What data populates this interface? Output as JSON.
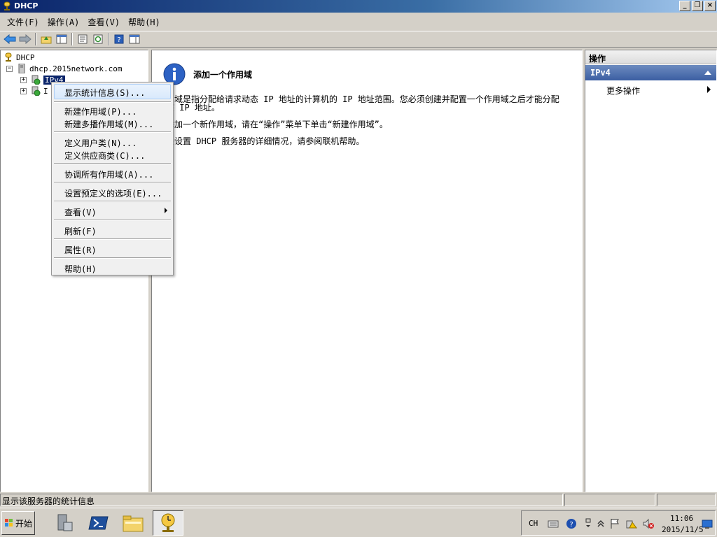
{
  "window": {
    "title": "DHCP"
  },
  "menu": [
    "文件(F)",
    "操作(A)",
    "查看(V)",
    "帮助(H)"
  ],
  "tree": {
    "root": "DHCP",
    "server": "dhcp.2015network.com",
    "ipv4": "IPv4",
    "ipv6_partial": "I"
  },
  "context_menu": {
    "items": [
      "显示统计信息(S)...",
      "新建作用域(P)...",
      "新建多播作用域(M)...",
      "定义用户类(N)...",
      "定义供应商类(C)...",
      "协调所有作用域(A)...",
      "设置预定义的选项(E)...",
      "查看(V)",
      "刷新(F)",
      "属性(R)",
      "帮助(H)"
    ]
  },
  "center": {
    "title": "添加一个作用域",
    "line1": "用域是指分配给请求动态 IP 地址的计算机的 IP 地址范围。您必须创建并配置一个作用域之后才能分配",
    "line2": "态 IP 地址。",
    "line3": "添加一个新作用域，请在“操作”菜单下单击“新建作用域”。",
    "line4": "关设置 DHCP 服务器的详细情况，请参阅联机帮助。"
  },
  "actions": {
    "header": "操作",
    "section": "IPv4",
    "more": "更多操作"
  },
  "status": {
    "text": "显示该服务器的统计信息"
  },
  "taskbar": {
    "start": "开始",
    "lang": "CH",
    "time": "11:06",
    "date": "2015/11/5"
  }
}
